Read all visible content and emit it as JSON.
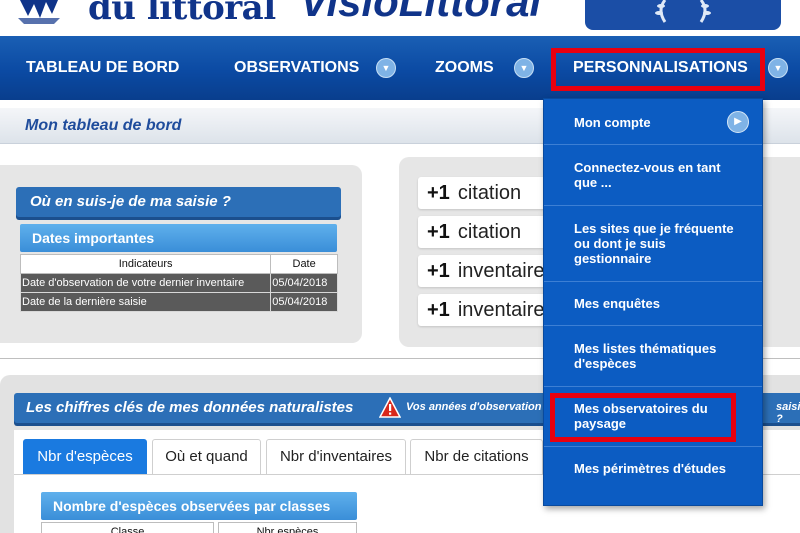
{
  "header": {
    "logo_text": "du littoral",
    "site_title": "VisioLittoral"
  },
  "nav": {
    "items": [
      {
        "label": "TABLEAU DE BORD"
      },
      {
        "label": "OBSERVATIONS"
      },
      {
        "label": "ZOOMS"
      },
      {
        "label": "PERSONNALISATIONS"
      }
    ],
    "arrow_glyph": "▼"
  },
  "page_title": "Mon tableau de bord",
  "saisie": {
    "title": "Où en suis-je de ma saisie ?",
    "dates_title": "Dates importantes",
    "table": {
      "headers": [
        "Indicateurs",
        "Date"
      ],
      "rows": [
        [
          "Date d'observation de votre dernier inventaire",
          "05/04/2018"
        ],
        [
          "Date de la dernière saisie",
          "05/04/2018"
        ]
      ]
    }
  },
  "stats": [
    {
      "plus": "+1",
      "label": "citation"
    },
    {
      "plus": "+1",
      "label": "citation"
    },
    {
      "plus": "+1",
      "label": "inventaire"
    },
    {
      "plus": "+1",
      "label": "inventaire"
    }
  ],
  "figures": {
    "title": "Les chiffres clés de mes données naturalistes",
    "years_text": "Vos années d'observation",
    "years_suffix": "saisie ?",
    "tabs": [
      {
        "label": "Nbr d'espèces",
        "active": true
      },
      {
        "label": "Où et quand",
        "active": false
      },
      {
        "label": "Nbr d'inventaires",
        "active": false
      },
      {
        "label": "Nbr de citations",
        "active": false
      }
    ],
    "species_title": "Nombre d'espèces observées par classes",
    "species_columns": [
      "Classe",
      "Nbr espèces"
    ]
  },
  "dropdown": {
    "items": [
      {
        "label": "Mon compte"
      },
      {
        "label": "Connectez-vous en tant que ..."
      },
      {
        "label": "Les sites que je fréquente ou dont je suis gestionnaire"
      },
      {
        "label": "Mes enquêtes"
      },
      {
        "label": "Mes listes thématiques d'espèces"
      },
      {
        "label": "Mes observatoires du paysage"
      },
      {
        "label": "Mes périmètres d'études"
      }
    ],
    "arrow_glyph": "▶"
  },
  "colors": {
    "nav_blue": "#0b4aa3",
    "dropdown_blue": "#0c5cc2",
    "highlight_red": "#e8000f",
    "tab_active": "#1a7ae0"
  },
  "icons": {
    "warning": "warning-icon",
    "logo": "logo-emblem-icon"
  }
}
